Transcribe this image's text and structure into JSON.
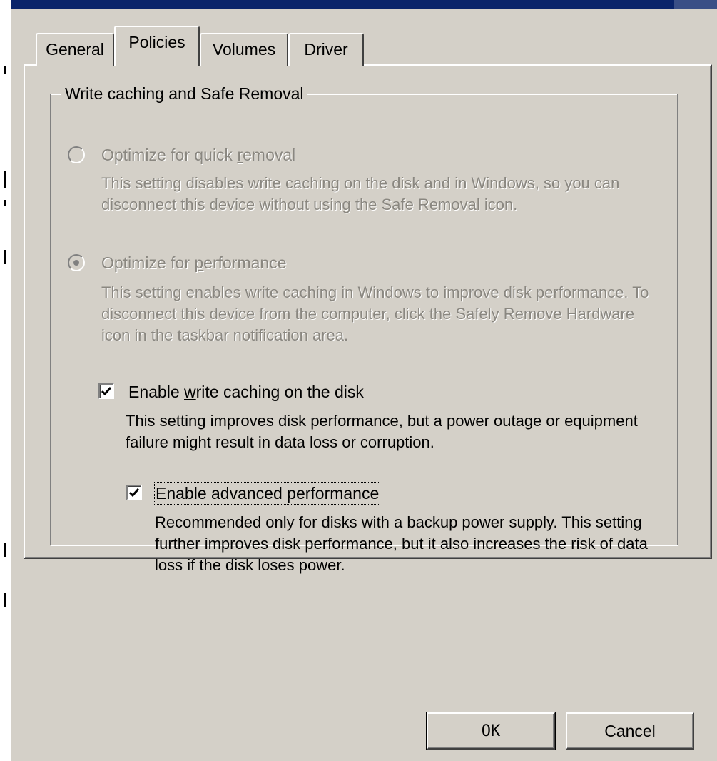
{
  "tabs": [
    {
      "label": "General"
    },
    {
      "label": "Policies"
    },
    {
      "label": "Volumes"
    },
    {
      "label": "Driver"
    }
  ],
  "active_tab": "Policies",
  "groupbox": {
    "title": "Write caching and Safe Removal"
  },
  "options": {
    "quick_removal": {
      "label_pre": "Optimize for quick ",
      "label_hot": "r",
      "label_post": "emoval",
      "description": "This setting disables write caching on the disk and in Windows, so you can disconnect this device without using the Safe Removal icon.",
      "selected": false,
      "enabled": false
    },
    "performance": {
      "label_pre": "Optimize for ",
      "label_hot": "p",
      "label_post": "erformance",
      "description": "This setting enables write caching in Windows to improve disk performance. To disconnect this device from the computer, click the Safely Remove Hardware icon in the taskbar notification area.",
      "selected": true,
      "enabled": false
    },
    "write_caching": {
      "label_pre": "Enable ",
      "label_hot": "w",
      "label_post": "rite caching on the disk",
      "description": "This setting improves disk performance, but a power outage or equipment failure might result in data loss or corruption.",
      "checked": true
    },
    "advanced_performance": {
      "label": "Enable advanced performance",
      "description": "Recommended only for disks with a backup power supply. This setting further improves disk performance, but it also increases the risk of data loss if the disk loses power.",
      "checked": true
    }
  },
  "buttons": {
    "ok": "OK",
    "cancel": "Cancel"
  },
  "colors": {
    "face": "#d4d0c8",
    "disabled_text": "#8a8780",
    "title_bar": "#0a246a"
  }
}
